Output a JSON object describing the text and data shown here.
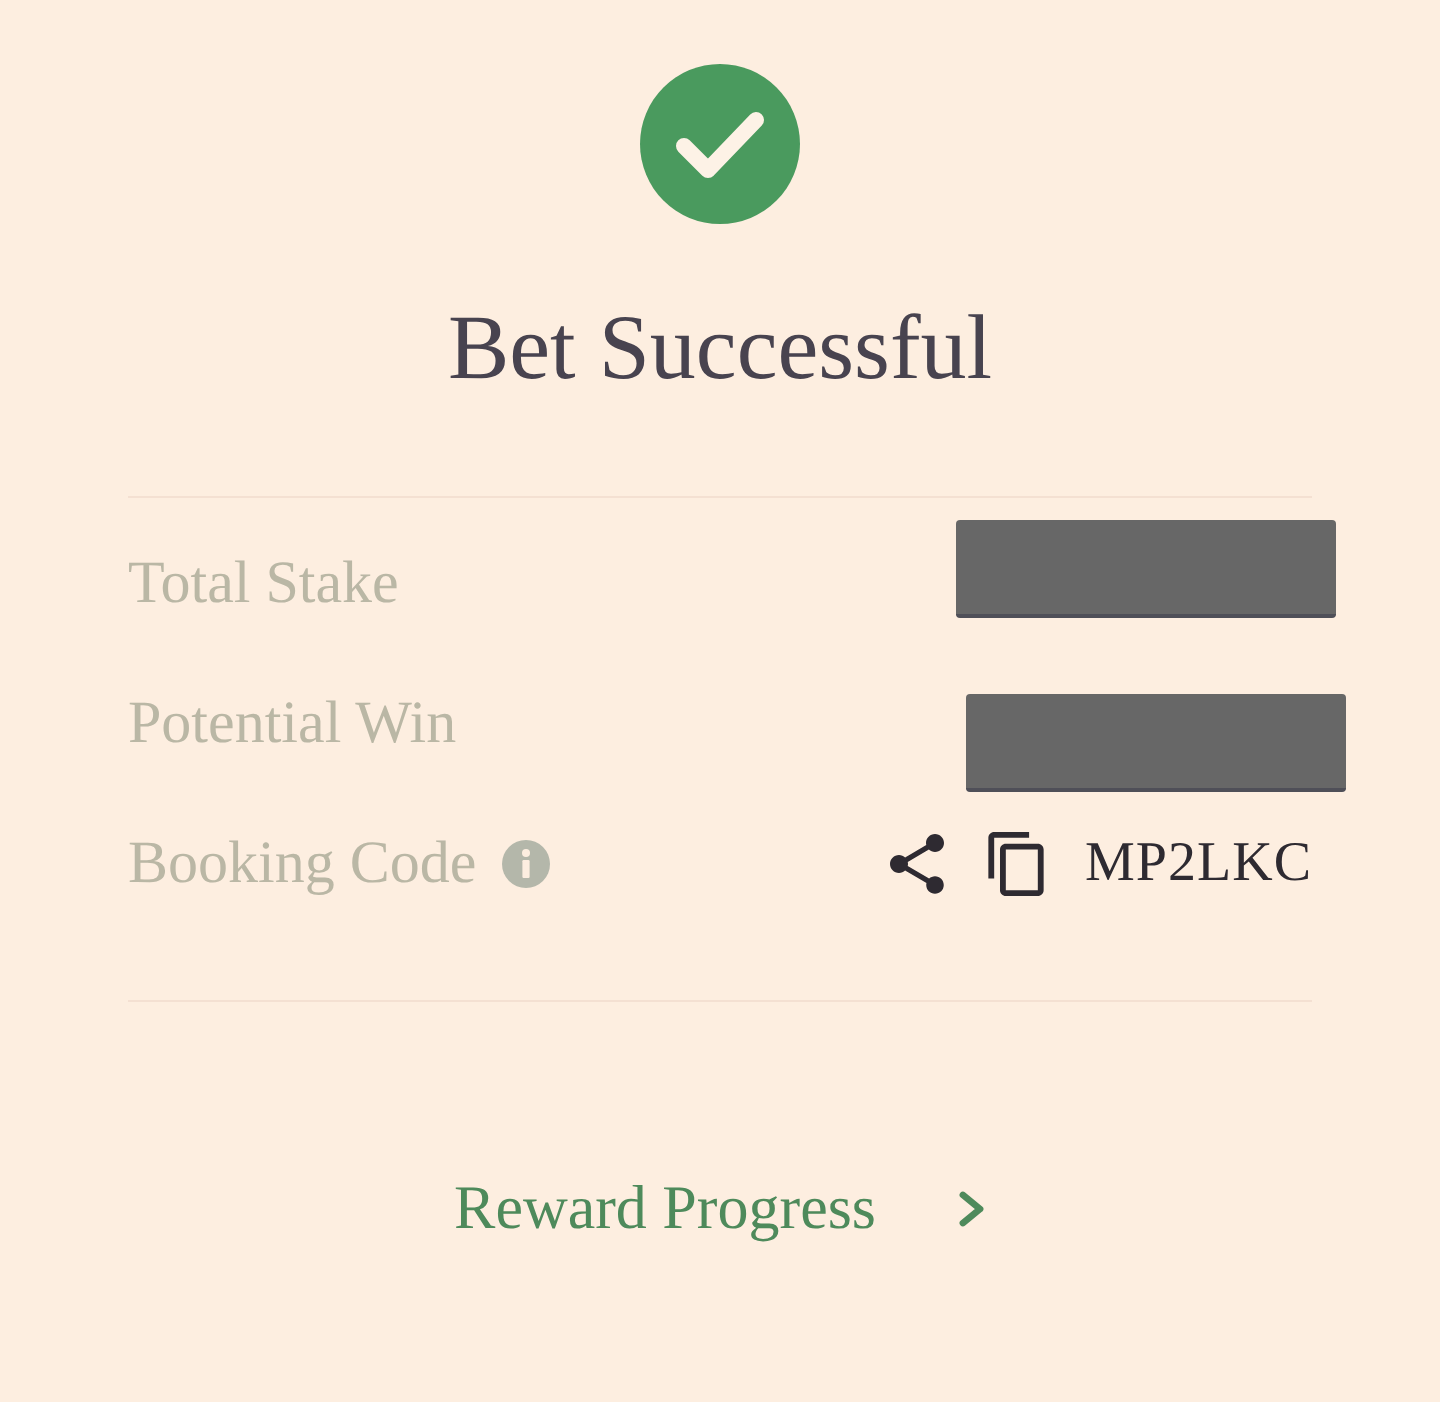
{
  "header": {
    "title": "Bet Successful"
  },
  "details": [
    {
      "kind": "redacted",
      "label": "Total Stake"
    },
    {
      "kind": "redacted",
      "label": "Potential Win"
    },
    {
      "kind": "code",
      "label": "Booking Code",
      "value": "MP2LKC"
    }
  ],
  "link": {
    "label": "Reward Progress"
  }
}
